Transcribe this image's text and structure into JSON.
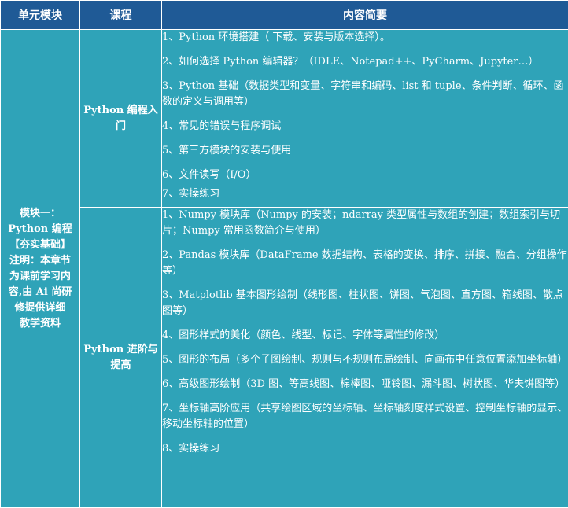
{
  "header": {
    "module": "单元模块",
    "course": "课程",
    "content": "内容简要"
  },
  "module": {
    "lines": [
      "模块一：",
      "Python 编程",
      "【夯实基础】",
      "注明：本章节",
      "为课前学习内",
      "容,由 Ai 尚研",
      "修提供详细",
      "教学资料"
    ]
  },
  "courses": [
    {
      "name": "Python 编程入门",
      "items": [
        "1、Python 环境搭建（ 下载、安装与版本选择）。",
        "2、如何选择 Python 编辑器？（IDLE、Notepad++、PyCharm、Jupyter…）",
        "3、Python 基础（数据类型和变量、字符串和编码、list 和 tuple、条件判断、循环、函数的定义与调用等）",
        "4、常见的错误与程序调试",
        "5、第三方模块的安装与使用",
        "6、文件读写（I/O）",
        "7、实操练习"
      ]
    },
    {
      "name": "Python 进阶与提高",
      "items": [
        "1、Numpy 模块库（Numpy 的安装；ndarray 类型属性与数组的创建；数组索引与切片；Numpy 常用函数简介与使用）",
        "2、Pandas 模块库（DataFrame 数据结构、表格的变换、排序、拼接、融合、分组操作等）",
        "3、Matplotlib 基本图形绘制（线形图、柱状图、饼图、气泡图、直方图、箱线图、散点图等）",
        "4、图形样式的美化（颜色、线型、标记、字体等属性的修改）",
        "5、图形的布局（多个子图绘制、规则与不规则布局绘制、向画布中任意位置添加坐标轴）",
        "6、高级图形绘制（3D 图、等高线图、棉棒图、哑铃图、漏斗图、树状图、华夫饼图等）",
        "7、坐标轴高阶应用（共享绘图区域的坐标轴、坐标轴刻度样式设置、控制坐标轴的显示、移动坐标轴的位置）",
        "8、实操练习"
      ]
    }
  ]
}
